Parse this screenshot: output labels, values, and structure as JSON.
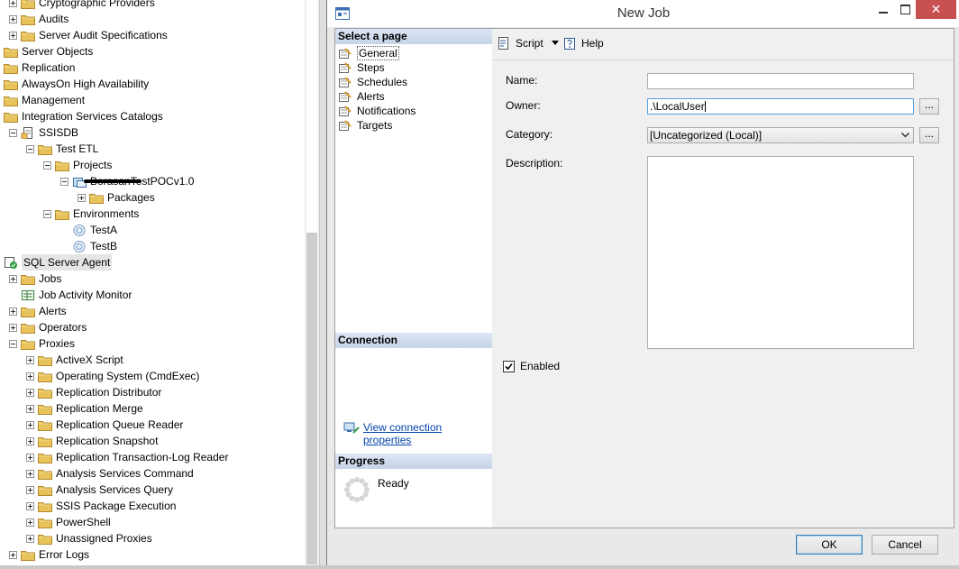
{
  "object_explorer": {
    "rows": [
      {
        "label": "Cryptographic Providers",
        "level": 2,
        "expander": "plus",
        "icon": "folder"
      },
      {
        "label": "Audits",
        "level": 2,
        "expander": "plus",
        "icon": "folder"
      },
      {
        "label": "Server Audit Specifications",
        "level": 2,
        "expander": "plus",
        "icon": "folder"
      },
      {
        "label": "Server Objects",
        "level": 1,
        "expander": "plus",
        "icon": "folder"
      },
      {
        "label": "Replication",
        "level": 1,
        "expander": "plus",
        "icon": "folder"
      },
      {
        "label": "AlwaysOn High Availability",
        "level": 1,
        "expander": "plus",
        "icon": "folder"
      },
      {
        "label": "Management",
        "level": 1,
        "expander": "plus",
        "icon": "folder"
      },
      {
        "label": "Integration Services Catalogs",
        "level": 1,
        "expander": "minus",
        "icon": "folder"
      },
      {
        "label": "SSISDB",
        "level": 2,
        "expander": "minus",
        "icon": "catalog"
      },
      {
        "label": "Test ETL",
        "level": 3,
        "expander": "minus",
        "icon": "folder"
      },
      {
        "label": "Projects",
        "level": 4,
        "expander": "minus",
        "icon": "folder"
      },
      {
        "label": "BorasanTestPOCv1.0",
        "level": 5,
        "expander": "minus",
        "icon": "project",
        "redacted": true
      },
      {
        "label": "Packages",
        "level": 6,
        "expander": "plus",
        "icon": "folder"
      },
      {
        "label": "Environments",
        "level": 4,
        "expander": "minus",
        "icon": "folder"
      },
      {
        "label": "TestA",
        "level": 5,
        "expander": "none",
        "icon": "environment"
      },
      {
        "label": "TestB",
        "level": 5,
        "expander": "none",
        "icon": "environment"
      },
      {
        "label": "SQL Server Agent",
        "level": 1,
        "expander": "minus",
        "icon": "agent",
        "selected": true
      },
      {
        "label": "Jobs",
        "level": 2,
        "expander": "plus",
        "icon": "folder"
      },
      {
        "label": "Job Activity Monitor",
        "level": 2,
        "expander": "none",
        "icon": "monitor"
      },
      {
        "label": "Alerts",
        "level": 2,
        "expander": "plus",
        "icon": "folder"
      },
      {
        "label": "Operators",
        "level": 2,
        "expander": "plus",
        "icon": "folder"
      },
      {
        "label": "Proxies",
        "level": 2,
        "expander": "minus",
        "icon": "folder"
      },
      {
        "label": "ActiveX Script",
        "level": 3,
        "expander": "plus",
        "icon": "folder"
      },
      {
        "label": "Operating System (CmdExec)",
        "level": 3,
        "expander": "plus",
        "icon": "folder"
      },
      {
        "label": "Replication Distributor",
        "level": 3,
        "expander": "plus",
        "icon": "folder"
      },
      {
        "label": "Replication Merge",
        "level": 3,
        "expander": "plus",
        "icon": "folder"
      },
      {
        "label": "Replication Queue Reader",
        "level": 3,
        "expander": "plus",
        "icon": "folder"
      },
      {
        "label": "Replication Snapshot",
        "level": 3,
        "expander": "plus",
        "icon": "folder"
      },
      {
        "label": "Replication Transaction-Log Reader",
        "level": 3,
        "expander": "plus",
        "icon": "folder"
      },
      {
        "label": "Analysis Services Command",
        "level": 3,
        "expander": "plus",
        "icon": "folder"
      },
      {
        "label": "Analysis Services Query",
        "level": 3,
        "expander": "plus",
        "icon": "folder"
      },
      {
        "label": "SSIS Package Execution",
        "level": 3,
        "expander": "plus",
        "icon": "folder"
      },
      {
        "label": "PowerShell",
        "level": 3,
        "expander": "plus",
        "icon": "folder"
      },
      {
        "label": "Unassigned Proxies",
        "level": 3,
        "expander": "plus",
        "icon": "folder"
      },
      {
        "label": "Error Logs",
        "level": 2,
        "expander": "plus",
        "icon": "folder"
      }
    ]
  },
  "dialog": {
    "title": "New Job",
    "close_glyph": "✕",
    "select_page_header": "Select a page",
    "pages": [
      "General",
      "Steps",
      "Schedules",
      "Alerts",
      "Notifications",
      "Targets"
    ],
    "connection_header": "Connection",
    "connection_link": "View connection properties",
    "progress_header": "Progress",
    "progress_status": "Ready",
    "toolbar": {
      "script_label": "Script",
      "help_label": "Help"
    },
    "form": {
      "name_label": "Name:",
      "name_value": "",
      "owner_label": "Owner:",
      "owner_value": ".\\LocalUser",
      "category_label": "Category:",
      "category_value": "[Uncategorized (Local)]",
      "description_label": "Description:",
      "description_value": "",
      "enabled_label": "Enabled",
      "enabled_checked": true,
      "browse_label": "..."
    },
    "buttons": {
      "ok": "OK",
      "cancel": "Cancel"
    }
  },
  "colors": {
    "folder": "#e8c25a",
    "section_header": "#c6d4e8",
    "close_button": "#c75050",
    "link": "#0645ad"
  }
}
